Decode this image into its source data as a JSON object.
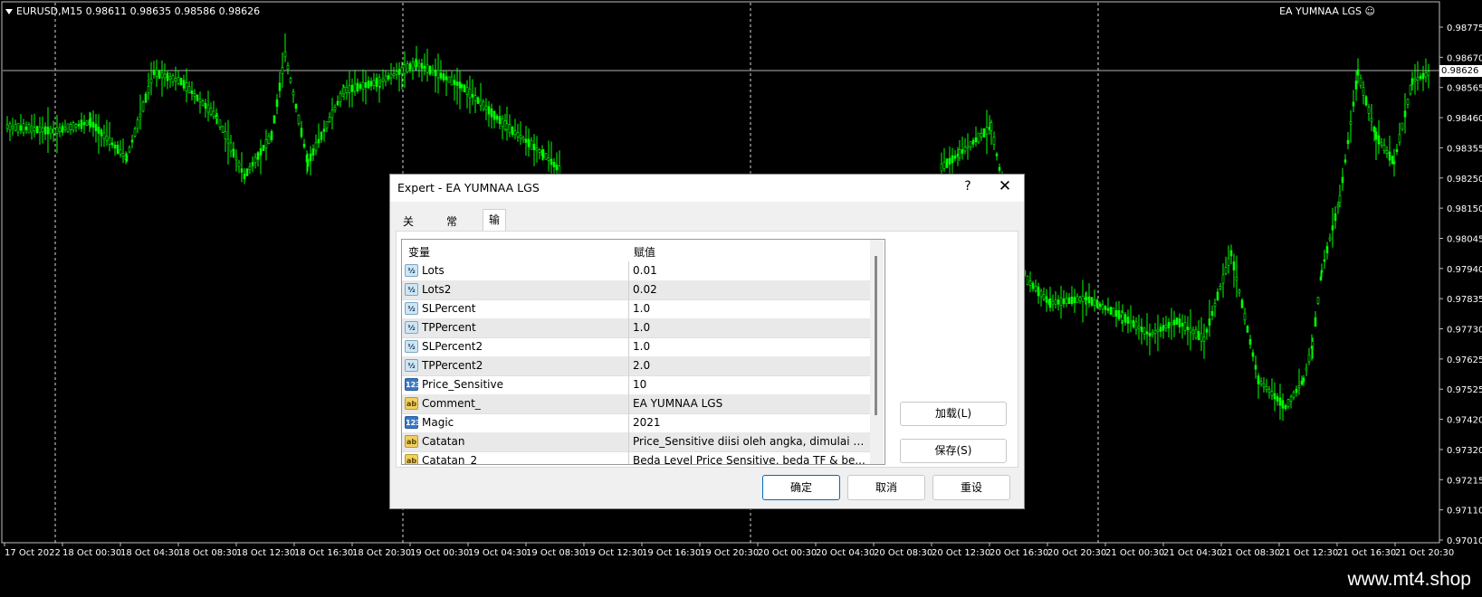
{
  "chart": {
    "symbol_info": "EURUSD,M15  0.98611 0.98635 0.98586 0.98626",
    "ea_label": "EA YUMNAA LGS",
    "current_price": "0.98626",
    "price_ticks": [
      "0.98775",
      "0.98670",
      "0.98565",
      "0.98460",
      "0.98355",
      "0.98250",
      "0.98150",
      "0.98045",
      "0.97940",
      "0.97835",
      "0.97730",
      "0.97625",
      "0.97525",
      "0.97420",
      "0.97320",
      "0.97215",
      "0.97110",
      "0.97010"
    ],
    "time_ticks": [
      "17 Oct 2022",
      "18 Oct 00:30",
      "18 Oct 04:30",
      "18 Oct 08:30",
      "18 Oct 12:30",
      "18 Oct 16:30",
      "18 Oct 20:30",
      "19 Oct 00:30",
      "19 Oct 04:30",
      "19 Oct 08:30",
      "19 Oct 12:30",
      "19 Oct 16:30",
      "19 Oct 20:30",
      "20 Oct 00:30",
      "20 Oct 04:30",
      "20 Oct 08:30",
      "20 Oct 12:30",
      "20 Oct 16:30",
      "20 Oct 20:30",
      "21 Oct 00:30",
      "21 Oct 04:30",
      "21 Oct 08:30",
      "21 Oct 12:30",
      "21 Oct 16:30",
      "21 Oct 20:30"
    ],
    "candle_color": "#00ff00",
    "background": "#000000"
  },
  "footer": {
    "watermark": "www.mt4.shop"
  },
  "dialog": {
    "title": "Expert - EA YUMNAA LGS",
    "help_label": "?",
    "close_label": "✕",
    "tabs": [
      {
        "label": "关于"
      },
      {
        "label": "常用"
      },
      {
        "label": "输入参数"
      }
    ],
    "active_tab": "输入参数",
    "columns": {
      "variable": "变量",
      "value": "赋值"
    },
    "params": [
      {
        "icon": "double",
        "icon_text": "½",
        "name": "Lots",
        "value": "0.01"
      },
      {
        "icon": "double",
        "icon_text": "½",
        "name": "Lots2",
        "value": "0.02"
      },
      {
        "icon": "double",
        "icon_text": "½",
        "name": "SLPercent",
        "value": "1.0"
      },
      {
        "icon": "double",
        "icon_text": "½",
        "name": "TPPercent",
        "value": "1.0"
      },
      {
        "icon": "double",
        "icon_text": "½",
        "name": "SLPercent2",
        "value": "1.0"
      },
      {
        "icon": "double",
        "icon_text": "½",
        "name": "TPPercent2",
        "value": "2.0"
      },
      {
        "icon": "int",
        "icon_text": "123",
        "name": "Price_Sensitive",
        "value": "10"
      },
      {
        "icon": "string",
        "icon_text": "ab",
        "name": "Comment_",
        "value": "EA YUMNAA LGS"
      },
      {
        "icon": "int",
        "icon_text": "123",
        "name": "Magic",
        "value": "2021"
      },
      {
        "icon": "string",
        "icon_text": "ab",
        "name": "Catatan",
        "value": "Price_Sensitive diisi oleh angka, dimulai d..."
      },
      {
        "icon": "string",
        "icon_text": "ab",
        "name": "Catatan_2",
        "value": "Beda Level Price Sensitive, beda TF & be..."
      }
    ],
    "load_label": "加载(L)",
    "save_label": "保存(S)",
    "ok_label": "确定",
    "cancel_label": "取消",
    "reset_label": "重设"
  }
}
